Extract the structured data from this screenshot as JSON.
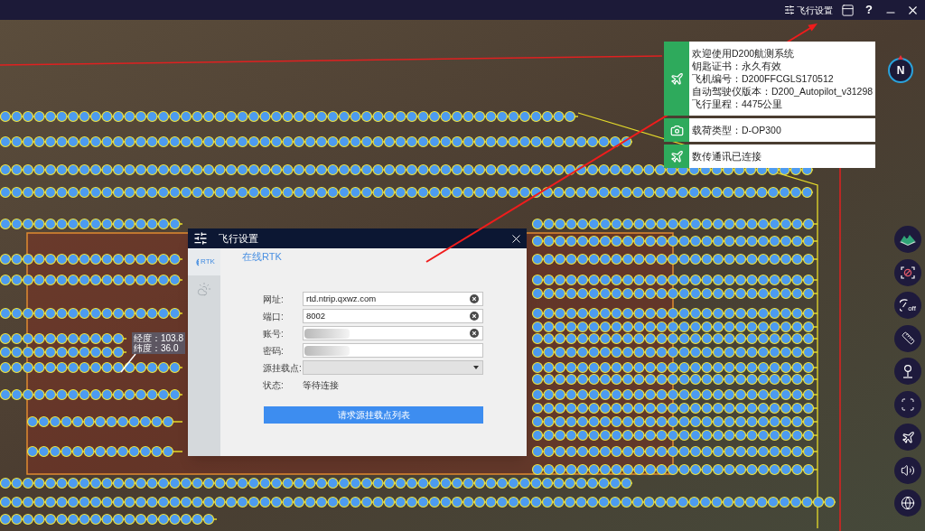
{
  "title_bar": {
    "settings_button": "飞行设置",
    "help_button": "?"
  },
  "map": {
    "tooltip": [
      "经度：103.8",
      "纬度：36.0"
    ]
  },
  "dialog": {
    "title": "飞行设置",
    "tabs": [
      {
        "kind": "rtk",
        "label": "RTK",
        "selected": true
      },
      {
        "kind": "cloud",
        "selected": false
      }
    ],
    "section_title": "在线RTK",
    "fields": [
      {
        "kind": "text",
        "label": "网址:",
        "value": "rtd.ntrip.qxwz.com",
        "clearable": true
      },
      {
        "kind": "text",
        "label": "端口:",
        "value": "8002",
        "clearable": true
      },
      {
        "kind": "masked",
        "label": "账号:",
        "clearable": true
      },
      {
        "kind": "masked",
        "label": "密码:",
        "clearable": false
      },
      {
        "kind": "select",
        "label": "源挂载点:"
      },
      {
        "kind": "status",
        "label": "状态:",
        "value": "等待连接"
      }
    ],
    "button": "请求源挂载点列表"
  },
  "info_panel": [
    {
      "kind": "plane",
      "lines": [
        "欢迎使用D200航测系统",
        "钥匙证书：永久有效",
        "飞机编号：D200FFCGLS170512",
        "自动驾驶仪版本：D200_Autopilot_v31298",
        "飞行里程：4475公里"
      ]
    },
    {
      "kind": "camera",
      "lines": [
        "载荷类型：D-OP300"
      ]
    },
    {
      "kind": "plane",
      "lines": [
        "数传通讯已连接"
      ]
    }
  ],
  "compass": {
    "label": "N"
  },
  "toolbar": [
    {
      "kind": "terrain"
    },
    {
      "kind": "camera-off"
    },
    {
      "kind": "gauge",
      "label": "off"
    },
    {
      "kind": "ruler"
    },
    {
      "kind": "joystick"
    },
    {
      "kind": "fullscreen"
    },
    {
      "kind": "plane"
    },
    {
      "kind": "speaker"
    },
    {
      "kind": "globe"
    }
  ]
}
